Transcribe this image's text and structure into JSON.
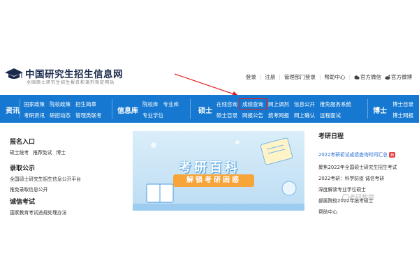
{
  "logo": {
    "title": "中国研究生招生信息网",
    "subtitle": "全国硕士研究生招生报名和调剂指定网站"
  },
  "top_links": {
    "login": "登录",
    "register": "注册",
    "admin_login": "管理部门登录",
    "help": "帮助中心",
    "weixin": "官方微信",
    "weibo": "官方微博"
  },
  "nav": {
    "zixun": {
      "label": "资讯",
      "row1": [
        "国家政策",
        "院校政策",
        "招生简章"
      ],
      "row2": [
        "考研资讯",
        "研招动态",
        "管理类联考"
      ]
    },
    "xinxiku": {
      "label": "信息库",
      "row1": [
        "院校库",
        "专业库"
      ],
      "row2": [
        "专业学位"
      ]
    },
    "shuoshi": {
      "label": "硕士",
      "row1": [
        "在线咨询",
        "成绩查询",
        "网上调剂",
        "信息公开",
        "推免服务系统"
      ],
      "row2": [
        "硕士目录",
        "网报公告",
        "统考网报",
        "网上确认",
        "远程面试"
      ]
    },
    "boshi": {
      "label": "博士",
      "row1": [
        "博士目录"
      ],
      "row2": [
        "博士网报"
      ]
    }
  },
  "left_panel": {
    "baoming": {
      "title": "报名入口",
      "links": [
        "硕士统考",
        "推荐免试",
        "博士"
      ]
    },
    "luqu": {
      "title": "录取公示",
      "items": [
        "全国硕士研究生招生信息公开平台",
        "推免录取信息公开"
      ]
    },
    "chengxin": {
      "title": "诚信考试",
      "items": [
        "国家教育考试违规处理办法"
      ]
    }
  },
  "banner": {
    "title": "考研百科",
    "ribbon": "解锁考研困惑"
  },
  "right_panel": {
    "title": "考研日程",
    "news": [
      {
        "text": "2022考研初试成绩查询时间汇总",
        "badge": "新"
      },
      {
        "text": "聚焦2022年全国硕士研究生招生考试"
      },
      {
        "text": "2022考研：科学防疫 诚信考研"
      },
      {
        "text": "深度解读专业学位硕士"
      },
      {
        "text": "部属院校2022年统考硕士"
      },
      {
        "text": "帮助中心"
      }
    ]
  },
  "watermark": "考研数据",
  "colors": {
    "nav_bg": "#1678d0",
    "highlight": "#e02020",
    "news_blue": "#2a6ed0",
    "ribbon": "#f7a43a"
  }
}
